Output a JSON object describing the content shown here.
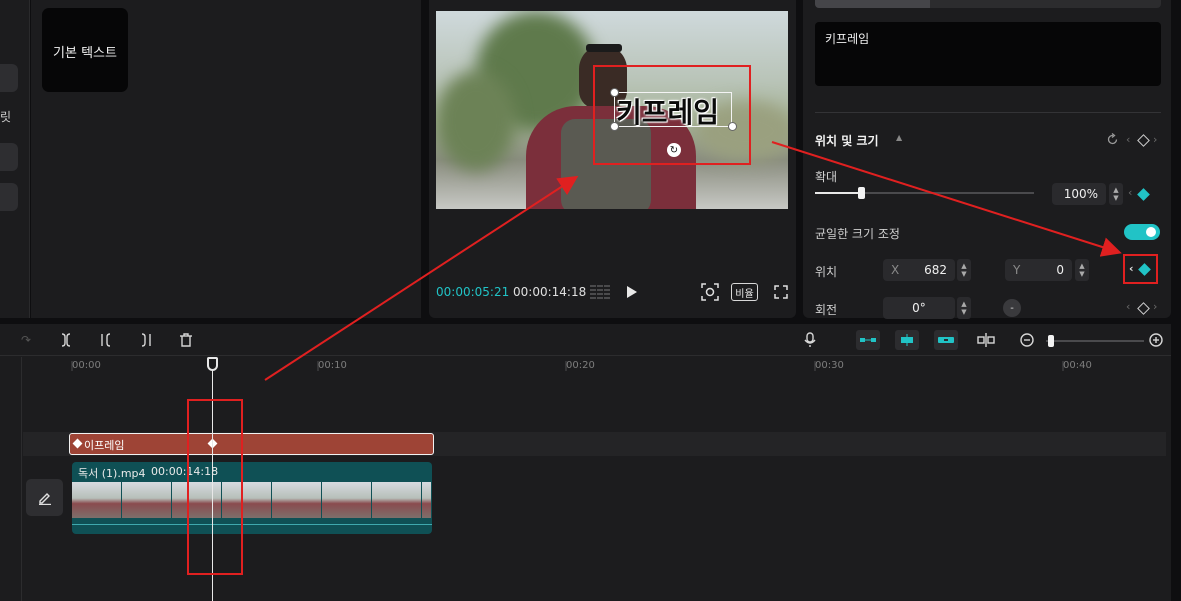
{
  "left_rail": {
    "label": "릿"
  },
  "media": {
    "tile_label": "기본 텍스트"
  },
  "player": {
    "title_text": "키프레임",
    "time_current": "00:00:05:21",
    "time_total": "00:00:14:18",
    "ratio_label": "비율"
  },
  "properties": {
    "text_value": "키프레임",
    "section_title": "위치 및 크기",
    "scale": {
      "label": "확대",
      "value": "100%",
      "fraction": 0.21
    },
    "uniform_label": "균일한 크기 조정",
    "uniform_on": true,
    "position": {
      "label": "위치",
      "x_label": "X",
      "x_value": "682",
      "y_label": "Y",
      "y_value": "0"
    },
    "rotation": {
      "label": "회전",
      "value": "0°"
    }
  },
  "timeline": {
    "ruler_ticks": [
      "00:00",
      "00:10",
      "00:20",
      "00:30",
      "00:40"
    ],
    "text_clip_label": "이프레임",
    "video_clip_name": "독서 (1).mp4",
    "video_clip_duration": "00:00:14:18",
    "zoom_fraction": 0.02
  },
  "colors": {
    "accent": "#21c3c6",
    "text_clip": "#9e4436",
    "video_clip": "#0f5055",
    "annotation": "#e02020"
  }
}
